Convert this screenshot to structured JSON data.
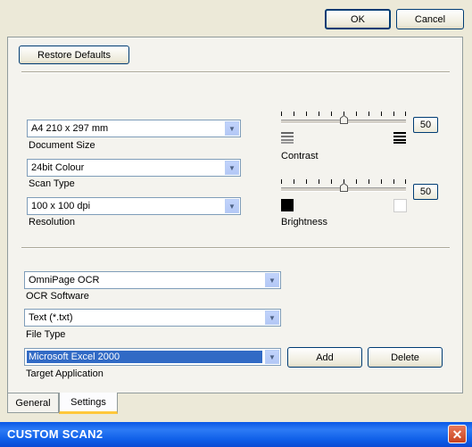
{
  "window": {
    "title": "CUSTOM SCAN2",
    "close_glyph": "✕"
  },
  "buttons": {
    "ok": "OK",
    "cancel": "Cancel",
    "restore": "Restore Defaults",
    "add": "Add",
    "delete": "Delete"
  },
  "tabs": [
    {
      "label": "General",
      "active": false
    },
    {
      "label": "Settings",
      "active": true
    }
  ],
  "fields": {
    "document_size": {
      "label": "Document Size",
      "value": "A4 210 x 297 mm"
    },
    "scan_type": {
      "label": "Scan Type",
      "value": "24bit Colour"
    },
    "resolution": {
      "label": "Resolution",
      "value": "100 x 100 dpi"
    },
    "ocr_software": {
      "label": "OCR Software",
      "value": "OmniPage OCR"
    },
    "file_type": {
      "label": "File Type",
      "value": "Text (*.txt)"
    },
    "target_application": {
      "label": "Target Application",
      "value": "Microsoft Excel 2000"
    }
  },
  "sliders": {
    "contrast": {
      "label": "Contrast",
      "value": "50",
      "level": 0.5
    },
    "brightness": {
      "label": "Brightness",
      "value": "50",
      "level": 0.5
    }
  },
  "icons": {
    "combo_arrow": "chevron-down-icon",
    "contrast_low": "contrast-low-icon",
    "contrast_high": "contrast-high-icon",
    "brightness_low": "brightness-dark-icon",
    "brightness_high": "brightness-light-icon"
  },
  "colors": {
    "titlebar": "#0a58e6",
    "selection": "#316ac5",
    "tab_highlight": "#ffc83c",
    "dialog_bg": "#ece9d8"
  }
}
